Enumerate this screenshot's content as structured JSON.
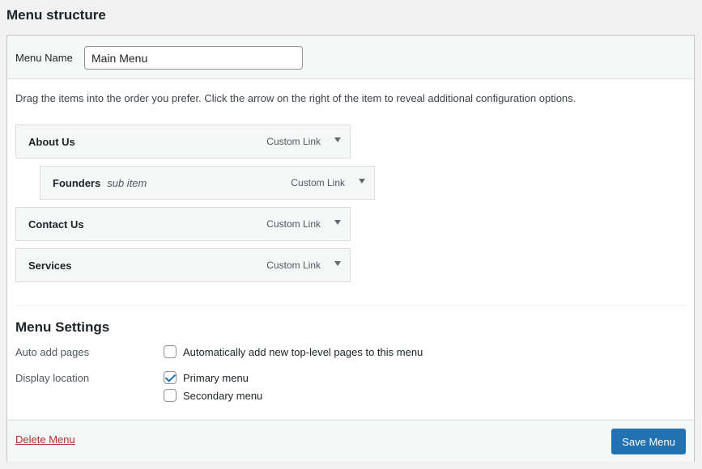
{
  "page_title": "Menu structure",
  "menu_name": {
    "label": "Menu Name",
    "value": "Main Menu"
  },
  "instructions": "Drag the items into the order you prefer. Click the arrow on the right of the item to reveal additional configuration options.",
  "items": [
    {
      "title": "About Us",
      "subitem": "",
      "type": "Custom Link",
      "depth": 0
    },
    {
      "title": "Founders",
      "subitem": "sub item",
      "type": "Custom Link",
      "depth": 1
    },
    {
      "title": "Contact Us",
      "subitem": "",
      "type": "Custom Link",
      "depth": 0
    },
    {
      "title": "Services",
      "subitem": "",
      "type": "Custom Link",
      "depth": 0
    }
  ],
  "settings": {
    "title": "Menu Settings",
    "auto_add": {
      "label": "Auto add pages",
      "option": "Automatically add new top-level pages to this menu",
      "checked": false
    },
    "display_location": {
      "label": "Display location",
      "options": [
        {
          "label": "Primary menu",
          "checked": true
        },
        {
          "label": "Secondary menu",
          "checked": false
        }
      ]
    }
  },
  "footer": {
    "delete_label": "Delete Menu",
    "save_label": "Save Menu"
  },
  "colors": {
    "accent": "#2271b1",
    "delete": "#b32d2e"
  },
  "icons": {
    "item_toggle": "arrow-down-icon",
    "checkbox_check": "checkmark-icon"
  }
}
